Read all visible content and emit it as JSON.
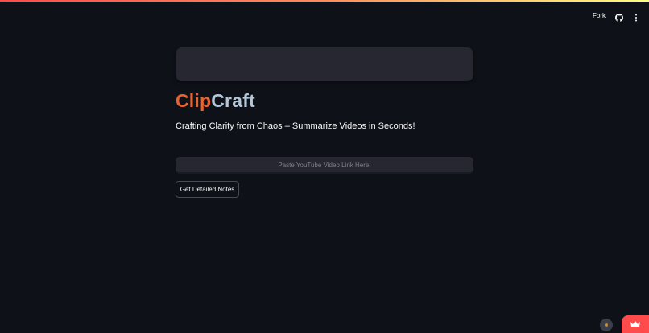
{
  "header": {
    "fork_label": "Fork",
    "github_icon": "github-icon",
    "menu_icon": "kebab-menu-icon"
  },
  "brand": {
    "part1": "Clip",
    "part2": "Craft",
    "part1_color": "#e8632f",
    "part2_color": "#b3c7d9"
  },
  "tagline": "Crafting Clarity from Chaos – Summarize Videos in Seconds!",
  "input": {
    "placeholder": "Paste YouTube Video Link Here.",
    "value": ""
  },
  "button": {
    "label": "Get Detailed Notes"
  },
  "footer": {
    "status_icon": "running-status-icon",
    "badge_icon": "crown-icon",
    "accent": "#ff4b4b"
  }
}
